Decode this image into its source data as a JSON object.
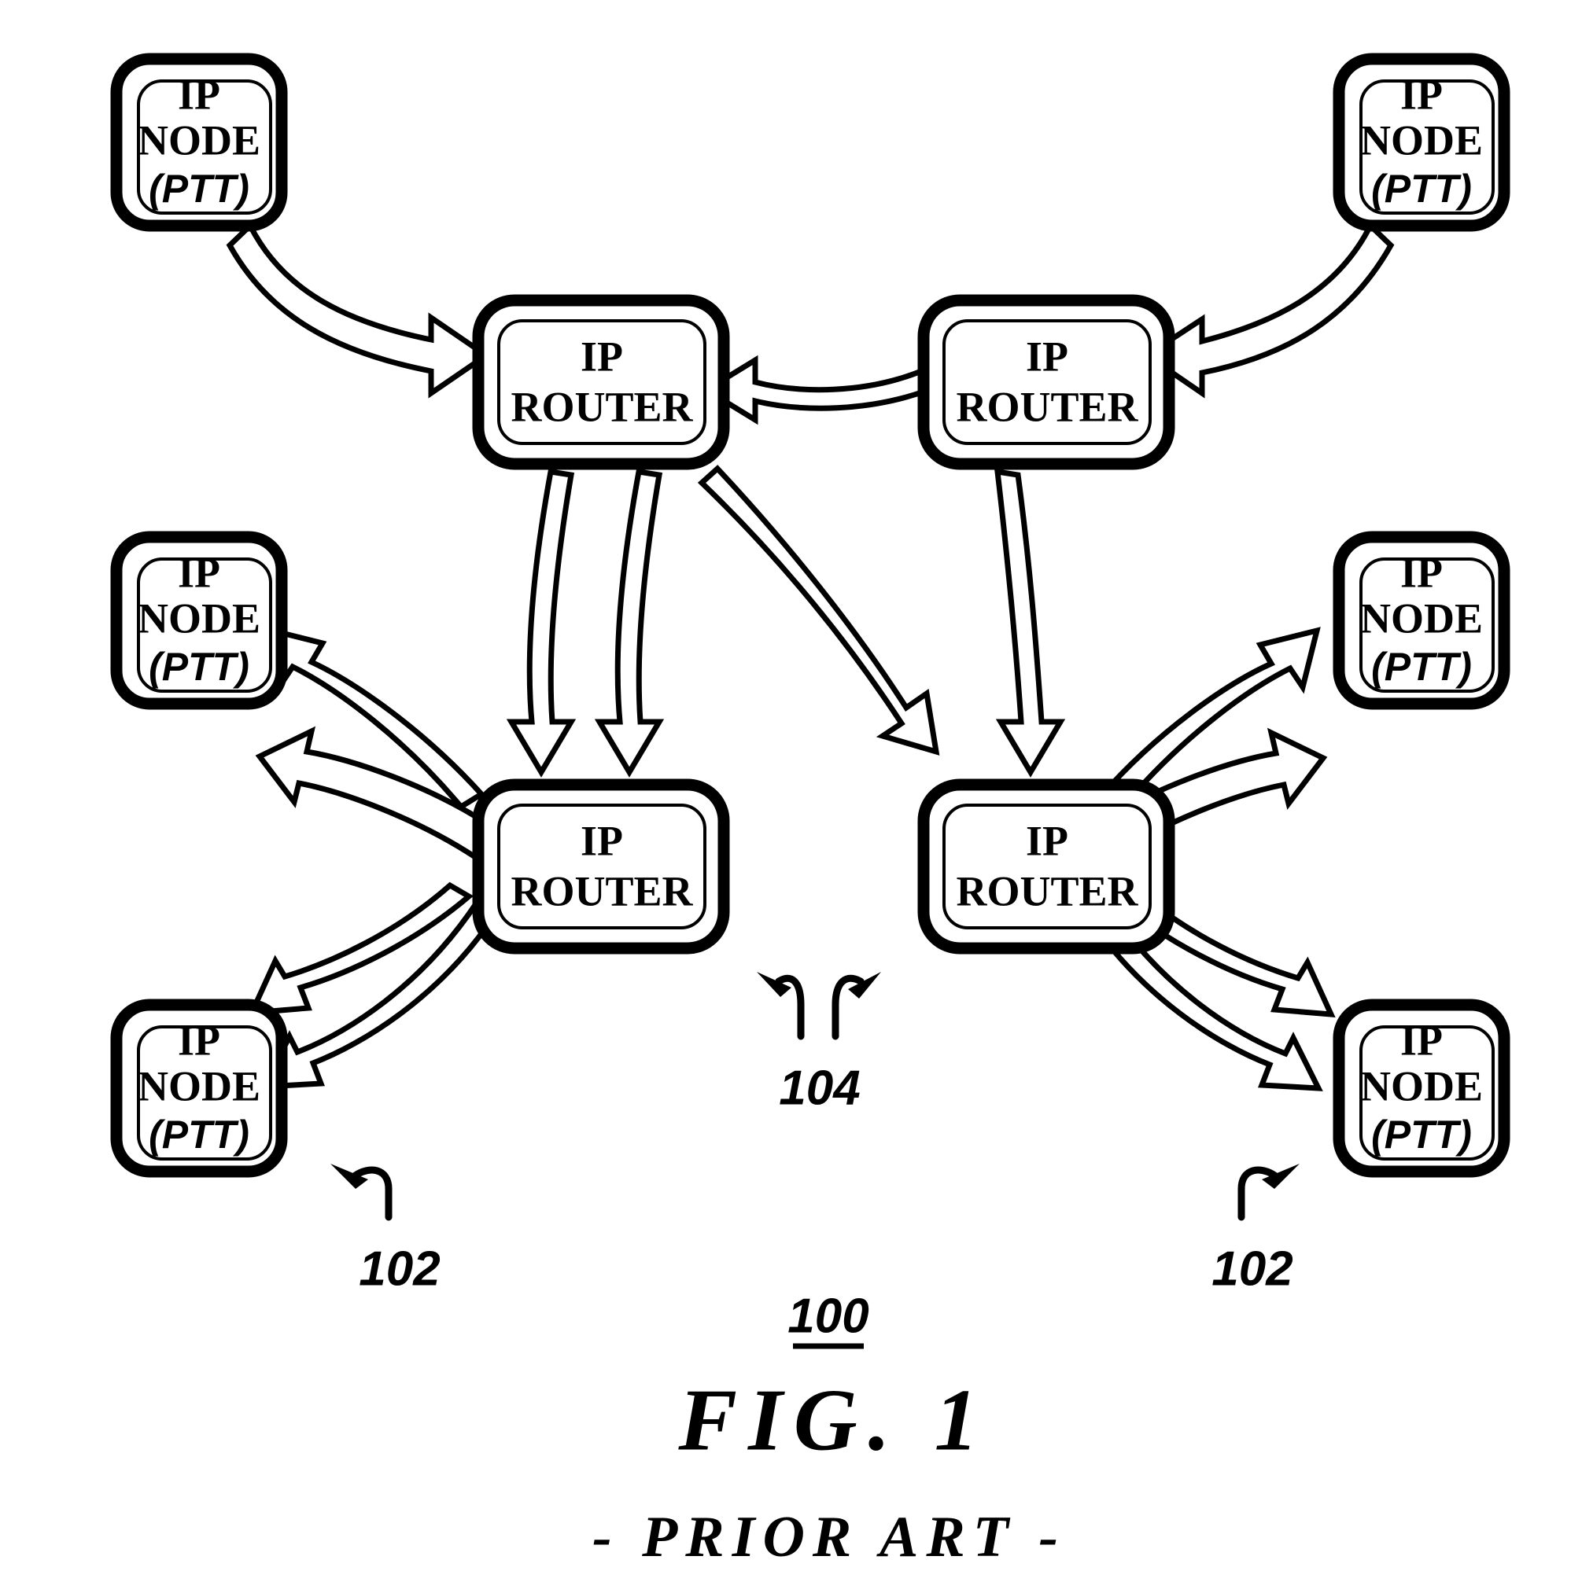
{
  "figure": {
    "number_label": "100",
    "caption": "FIG. 1",
    "subcaption": "- PRIOR ART -"
  },
  "nodes": [
    {
      "id": "node-top-left",
      "line1": "IP",
      "line2": "NODE",
      "line3": "(PTT)"
    },
    {
      "id": "node-top-right",
      "line1": "IP",
      "line2": "NODE",
      "line3": "(PTT)"
    },
    {
      "id": "node-mid-left",
      "line1": "IP",
      "line2": "NODE",
      "line3": "(PTT)"
    },
    {
      "id": "node-mid-right",
      "line1": "IP",
      "line2": "NODE",
      "line3": "(PTT)"
    },
    {
      "id": "node-bottom-left",
      "line1": "IP",
      "line2": "NODE",
      "line3": "(PTT)"
    },
    {
      "id": "node-bottom-right",
      "line1": "IP",
      "line2": "NODE",
      "line3": "(PTT)"
    }
  ],
  "routers": [
    {
      "id": "router-upper-left",
      "line1": "IP",
      "line2": "ROUTER"
    },
    {
      "id": "router-upper-right",
      "line1": "IP",
      "line2": "ROUTER"
    },
    {
      "id": "router-lower-left",
      "line1": "IP",
      "line2": "ROUTER"
    },
    {
      "id": "router-lower-right",
      "line1": "IP",
      "line2": "ROUTER"
    }
  ],
  "reference_labels": [
    {
      "id": "ref-104",
      "text": "104"
    },
    {
      "id": "ref-102-left",
      "text": "102"
    },
    {
      "id": "ref-102-right",
      "text": "102"
    }
  ],
  "colors": {
    "ink": "#000000",
    "paper": "#ffffff"
  }
}
